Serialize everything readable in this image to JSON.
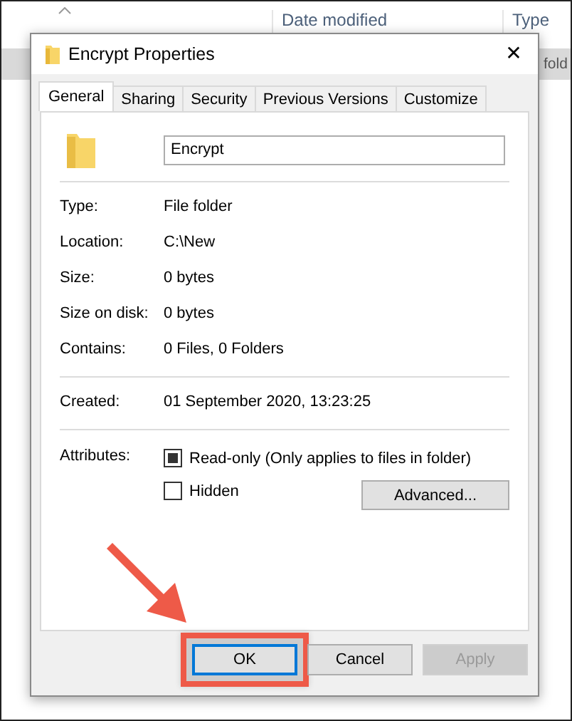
{
  "explorer": {
    "columns": [
      "Date modified",
      "Type"
    ],
    "row": {
      "type_cell": "fold",
      "selected": true
    }
  },
  "dialog": {
    "title": "Encrypt Properties",
    "close": "✕",
    "tabs": [
      {
        "label": "General",
        "selected": true
      },
      {
        "label": "Sharing",
        "selected": false
      },
      {
        "label": "Security",
        "selected": false
      },
      {
        "label": "Previous Versions",
        "selected": false
      },
      {
        "label": "Customize",
        "selected": false
      }
    ],
    "name_field": {
      "value": "Encrypt"
    },
    "groups": [
      [
        {
          "label": "Type:",
          "value": "File folder"
        },
        {
          "label": "Location:",
          "value": "C:\\New"
        },
        {
          "label": "Size:",
          "value": "0 bytes"
        },
        {
          "label": "Size on disk:",
          "value": "0 bytes"
        },
        {
          "label": "Contains:",
          "value": "0 Files, 0 Folders"
        }
      ],
      [
        {
          "label": "Created:",
          "value": "01 September 2020, 13:23:25"
        }
      ]
    ],
    "attributes": {
      "label": "Attributes:",
      "checkboxes": [
        {
          "label": "Read-only (Only applies to files in folder)",
          "mixed": true
        },
        {
          "label": "Hidden",
          "checked": false
        }
      ],
      "advanced_button": "Advanced..."
    },
    "buttons": [
      {
        "label": "OK",
        "default": true,
        "disabled": false,
        "highlighted": true
      },
      {
        "label": "Cancel",
        "default": false,
        "disabled": false,
        "highlighted": false
      },
      {
        "label": "Apply",
        "default": false,
        "disabled": true,
        "highlighted": false
      }
    ]
  }
}
